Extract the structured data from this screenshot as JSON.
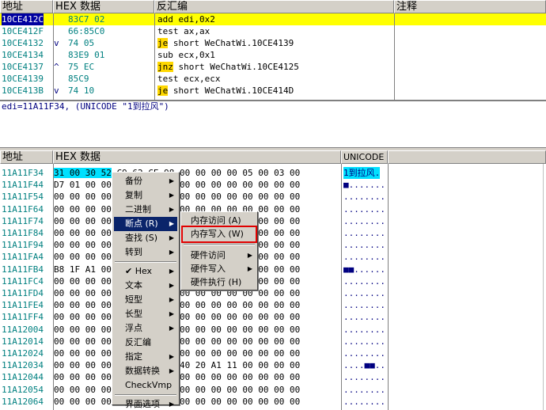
{
  "disasm": {
    "headers": [
      "地址",
      "HEX 数据",
      "反汇编",
      "注释"
    ],
    "rows": [
      {
        "addr": "10CE412C",
        "mark": " ",
        "hex": "83C7 02",
        "asm": "add edi,0x2",
        "op": "",
        "rest": ""
      },
      {
        "addr": "10CE412F",
        "mark": " ",
        "hex": "66:85C0",
        "asm": "test ax,ax",
        "op": "",
        "rest": ""
      },
      {
        "addr": "10CE4132",
        "mark": "v",
        "hex": "74 05",
        "asm": "",
        "op": "je",
        "rest": " short WeChatWi.10CE4139"
      },
      {
        "addr": "10CE4134",
        "mark": " ",
        "hex": "83E9 01",
        "asm": "sub ecx,0x1",
        "op": "",
        "rest": ""
      },
      {
        "addr": "10CE4137",
        "mark": "^",
        "hex": "75 EC",
        "asm": "",
        "op": "jnz",
        "rest": " short WeChatWi.10CE4125"
      },
      {
        "addr": "10CE4139",
        "mark": " ",
        "hex": "85C9",
        "asm": "test ecx,ecx",
        "op": "",
        "rest": ""
      },
      {
        "addr": "10CE413B",
        "mark": "v",
        "hex": "74 10",
        "asm": "",
        "op": "je",
        "rest": " short WeChatWi.10CE414D"
      }
    ]
  },
  "info": {
    "text": "edi=11A11F34, (UNICODE \"1到拉风\")"
  },
  "dump": {
    "headers": [
      "地址",
      "HEX 数据",
      "UNICODE"
    ],
    "rows": [
      {
        "addr": "11A11F34",
        "hex": "31 00 30 52 C9 62 CE 98 00 00 00 00 05 00 03 00",
        "uni": "1到拉风."
      },
      {
        "addr": "11A11F44",
        "hex": "D7 01 00 00 00 00 00 00 00 00 00 00 00 00 00 00",
        "uni": "■......."
      },
      {
        "addr": "11A11F54",
        "hex": "00 00 00 00 00 00 00 00 00 00 00 00 00 00 00 00",
        "uni": "........"
      },
      {
        "addr": "11A11F64",
        "hex": "00 00 00 00 00 00 00 00 00 00 00 00 00 00 00 00",
        "uni": "........"
      },
      {
        "addr": "11A11F74",
        "hex": "00 00 00 00 00 00 00 00 00 00 00 00 00 00 00 00",
        "uni": "........"
      },
      {
        "addr": "11A11F84",
        "hex": "00 00 00 00 00 00 00 00 00 00 00 00 00 00 00 00",
        "uni": "........"
      },
      {
        "addr": "11A11F94",
        "hex": "00 00 00 00 00 00 00 00 00 00 00 00 00 00 00 00",
        "uni": "........"
      },
      {
        "addr": "11A11FA4",
        "hex": "00 00 00 00 00 00 00 00 00 00 00 00 00 00 00 00",
        "uni": "........"
      },
      {
        "addr": "11A11FB4",
        "hex": "B8 1F A1 00 00 00 00 00 00 00 00 00 00 00 00 00",
        "uni": "■■......"
      },
      {
        "addr": "11A11FC4",
        "hex": "00 00 00 00 00 00 00 00 00 00 00 00 00 00 00 00",
        "uni": "........"
      },
      {
        "addr": "11A11FD4",
        "hex": "00 00 00 00 00 00 00 00 00 00 00 00 00 00 00 00",
        "uni": "........"
      },
      {
        "addr": "11A11FE4",
        "hex": "00 00 00 00 00 00 00 00 00 00 00 00 00 00 00 00",
        "uni": "........"
      },
      {
        "addr": "11A11FF4",
        "hex": "00 00 00 00 00 00 00 00 00 00 00 00 00 00 00 00",
        "uni": "........"
      },
      {
        "addr": "11A12004",
        "hex": "00 00 00 00 00 00 00 00 00 00 00 00 00 00 00 00",
        "uni": "........"
      },
      {
        "addr": "11A12014",
        "hex": "00 00 00 00 00 00 00 00 00 00 00 00 00 00 00 00",
        "uni": "........"
      },
      {
        "addr": "11A12024",
        "hex": "00 00 00 00 00 00 00 00 00 00 00 00 00 00 00 00",
        "uni": "........"
      },
      {
        "addr": "11A12034",
        "hex": "00 00 00 00 00 00 00 00 40 20 A1 11 00 00 00 00",
        "uni": "....■■.."
      },
      {
        "addr": "11A12044",
        "hex": "00 00 00 00 00 00 00 00 00 00 00 00 00 00 00 00",
        "uni": "........"
      },
      {
        "addr": "11A12054",
        "hex": "00 00 00 00 00 00 00 00 00 00 00 00 00 00 00 00",
        "uni": "........"
      },
      {
        "addr": "11A12064",
        "hex": "00 00 00 00 00 00 00 00 00 00 00 00 00 00 00 00",
        "uni": "........"
      }
    ]
  },
  "context_menu": {
    "items": [
      {
        "label": "备份",
        "sub": true
      },
      {
        "label": "复制",
        "sub": true
      },
      {
        "label": "二进制",
        "sub": true
      },
      {
        "label": "断点 (R)",
        "sub": true,
        "hl": true
      },
      {
        "label": "查找 (S)",
        "sub": true
      },
      {
        "label": "转到",
        "sub": true
      },
      {
        "label": "✔ Hex",
        "sub": true
      },
      {
        "label": "文本",
        "sub": true
      },
      {
        "label": "短型",
        "sub": true
      },
      {
        "label": "长型",
        "sub": true
      },
      {
        "label": "浮点",
        "sub": true
      },
      {
        "label": "反汇编",
        "sub": false
      },
      {
        "label": "指定",
        "sub": true
      },
      {
        "label": "数据转换",
        "sub": true
      },
      {
        "label": "CheckVmp",
        "sub": false
      },
      {
        "label": "界面选项",
        "sub": true
      }
    ]
  },
  "submenu": {
    "items": [
      {
        "label": "内存访问 (A)",
        "sub": false
      },
      {
        "label": "内存写入 (W)",
        "sub": false,
        "boxed": true
      },
      {
        "label": "硬件访问",
        "sub": true
      },
      {
        "label": "硬件写入",
        "sub": true
      },
      {
        "label": "硬件执行 (H)",
        "sub": false
      }
    ]
  },
  "colors": {
    "highlight": "#ffff00",
    "address": "#008080",
    "jump_bg": "#ffd800",
    "selection": "#0a246a",
    "annotation_box": "#e00000"
  }
}
